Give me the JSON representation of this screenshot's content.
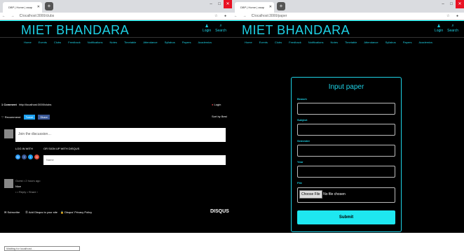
{
  "left": {
    "tab": "DBP | Home | asap",
    "url": "localhost:3000/clubs",
    "brand": "MIET BHANDARA",
    "login": "Login",
    "search": "Search",
    "menu": [
      "Home",
      "Events",
      "Clubs",
      "Feedback",
      "Notifications",
      "Notes",
      "Timetable",
      "Attendance",
      "Syllabus",
      "Papers",
      "Academics"
    ],
    "disqus": {
      "count": "1 Comment",
      "site": "http://localhost:3000/clubs",
      "login": "Login",
      "recommend": "Recommend",
      "tweet": "Tweet",
      "share": "Share",
      "sort": "Sort by Best",
      "placeholder": "Join the discussion…",
      "login_with": "LOG IN WITH",
      "signup": "OR SIGN UP WITH DISQUS",
      "name_placeholder": "Name",
      "commenter": "Nice",
      "reply_meta": "• • Reply • Share ›",
      "meta_time": "Guest • 2 hours ago",
      "footer_subscribe": "Subscribe",
      "footer_add": "Add Disqus to your site",
      "footer_privacy": "Disqus' Privacy Policy",
      "brand": "DISQUS"
    }
  },
  "right": {
    "tab": "DBP | Home | asap",
    "url": "localhost:3000/paper",
    "brand": "MIET BHANDARA",
    "login": "Login",
    "search": "Search",
    "menu": [
      "Home",
      "Events",
      "Clubs",
      "Feedback",
      "Notifications",
      "Notes",
      "Timetable",
      "Attendance",
      "Syllabus",
      "Papers",
      "Academics"
    ],
    "form": {
      "title": "Input paper",
      "fields": [
        "Branch",
        "Subject",
        "Semester",
        "Year"
      ],
      "file_label": "File",
      "choose": "Choose File",
      "no_file": "No file chosen",
      "submit": "Submit"
    }
  },
  "status": "Waiting for localhost…"
}
